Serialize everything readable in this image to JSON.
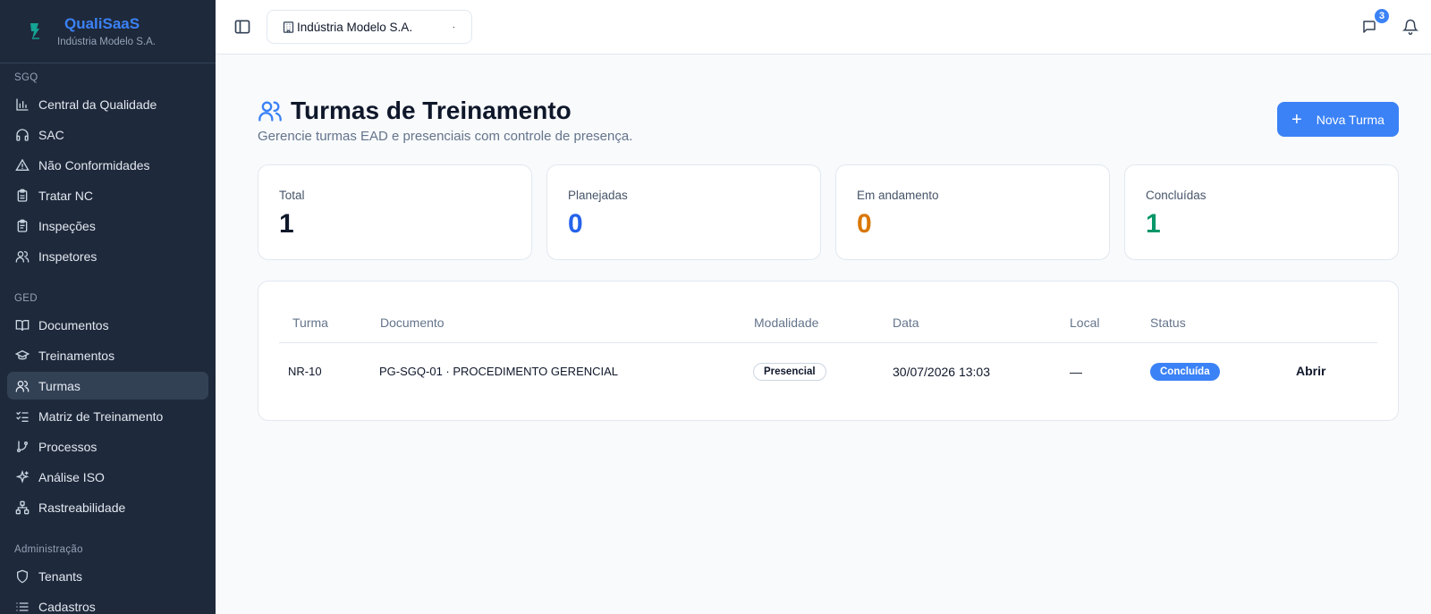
{
  "brand": {
    "name": "QualiSaaS",
    "tenant": "Indústria Modelo S.A."
  },
  "sidebar": {
    "sections": [
      {
        "label": "SGQ",
        "items": [
          {
            "label": "Central da Qualidade",
            "icon": "bar-chart-icon"
          },
          {
            "label": "SAC",
            "icon": "headphones-icon"
          },
          {
            "label": "Não Conformidades",
            "icon": "warning-icon"
          },
          {
            "label": "Tratar NC",
            "icon": "clipboard-icon"
          },
          {
            "label": "Inspeções",
            "icon": "clipboard-check-icon"
          },
          {
            "label": "Inspetores",
            "icon": "users-icon"
          }
        ]
      },
      {
        "label": "GED",
        "items": [
          {
            "label": "Documentos",
            "icon": "book-icon"
          },
          {
            "label": "Treinamentos",
            "icon": "graduation-cap-icon"
          },
          {
            "label": "Turmas",
            "icon": "users-icon",
            "active": true
          },
          {
            "label": "Matriz de Treinamento",
            "icon": "list-check-icon"
          },
          {
            "label": "Processos",
            "icon": "git-branch-icon"
          },
          {
            "label": "Análise ISO",
            "icon": "sparkles-icon"
          },
          {
            "label": "Rastreabilidade",
            "icon": "network-icon"
          }
        ]
      },
      {
        "label": "Administração",
        "items": [
          {
            "label": "Tenants",
            "icon": "shield-icon"
          },
          {
            "label": "Cadastros",
            "icon": "list-icon"
          }
        ]
      }
    ]
  },
  "header": {
    "tenant_select": "Indústria Modelo S.A.",
    "tenant_dot": "·",
    "messages_badge": "3"
  },
  "page": {
    "title": "Turmas de Treinamento",
    "subtitle": "Gerencie turmas EAD e presenciais com controle de presença.",
    "new_button": "Nova Turma"
  },
  "stats": [
    {
      "label": "Total",
      "value": "1",
      "color": "#0f172a"
    },
    {
      "label": "Planejadas",
      "value": "0",
      "color": "#2563eb"
    },
    {
      "label": "Em andamento",
      "value": "0",
      "color": "#d97706"
    },
    {
      "label": "Concluídas",
      "value": "1",
      "color": "#059669"
    }
  ],
  "table": {
    "headers": [
      "Turma",
      "Documento",
      "Modalidade",
      "Data",
      "Local",
      "Status"
    ],
    "rows": [
      {
        "turma": "NR-10",
        "documento": "PG-SGQ-01 · PROCEDIMENTO GERENCIAL",
        "modalidade": "Presencial",
        "data": "30/07/2026 13:03",
        "local": "—",
        "status": "Concluída",
        "action": "Abrir"
      }
    ]
  },
  "colors": {
    "accent": "#3b82f6",
    "sidebar_bg": "#1e293b"
  }
}
